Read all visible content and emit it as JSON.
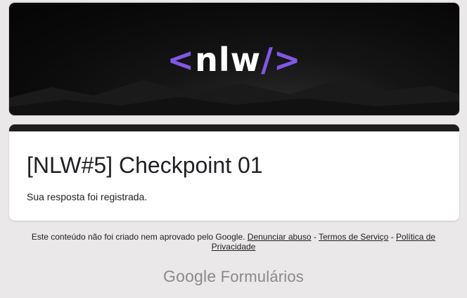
{
  "header": {
    "logo_open": "<",
    "logo_text": "nlw",
    "logo_close": "/>",
    "accent_color": "#8257e5"
  },
  "form": {
    "title": "[NLW#5] Checkpoint 01",
    "confirmation": "Sua resposta foi registrada."
  },
  "footer": {
    "disclaimer": "Este conteúdo não foi criado nem aprovado pelo Google.",
    "sep": " - ",
    "report_abuse": "Denunciar abuso",
    "terms": "Termos de Serviço",
    "privacy": "Política de Privacidade",
    "brand_google": "Google",
    "brand_product": "Formulários"
  }
}
